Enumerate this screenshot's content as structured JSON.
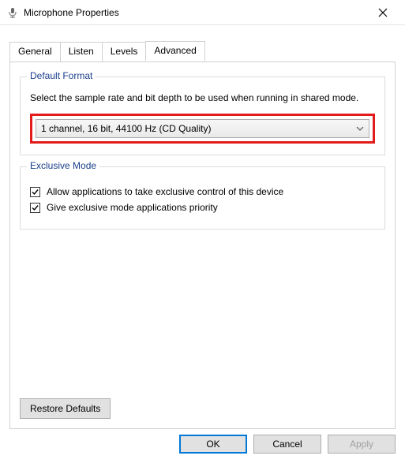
{
  "title": "Microphone Properties",
  "tabs": {
    "general": "General",
    "listen": "Listen",
    "levels": "Levels",
    "advanced": "Advanced"
  },
  "defaultFormat": {
    "legend": "Default Format",
    "description": "Select the sample rate and bit depth to be used when running in shared mode.",
    "selected": "1 channel, 16 bit, 44100 Hz (CD Quality)"
  },
  "exclusiveMode": {
    "legend": "Exclusive Mode",
    "allow": "Allow applications to take exclusive control of this device",
    "priority": "Give exclusive mode applications priority"
  },
  "restore": "Restore Defaults",
  "buttons": {
    "ok": "OK",
    "cancel": "Cancel",
    "apply": "Apply"
  }
}
